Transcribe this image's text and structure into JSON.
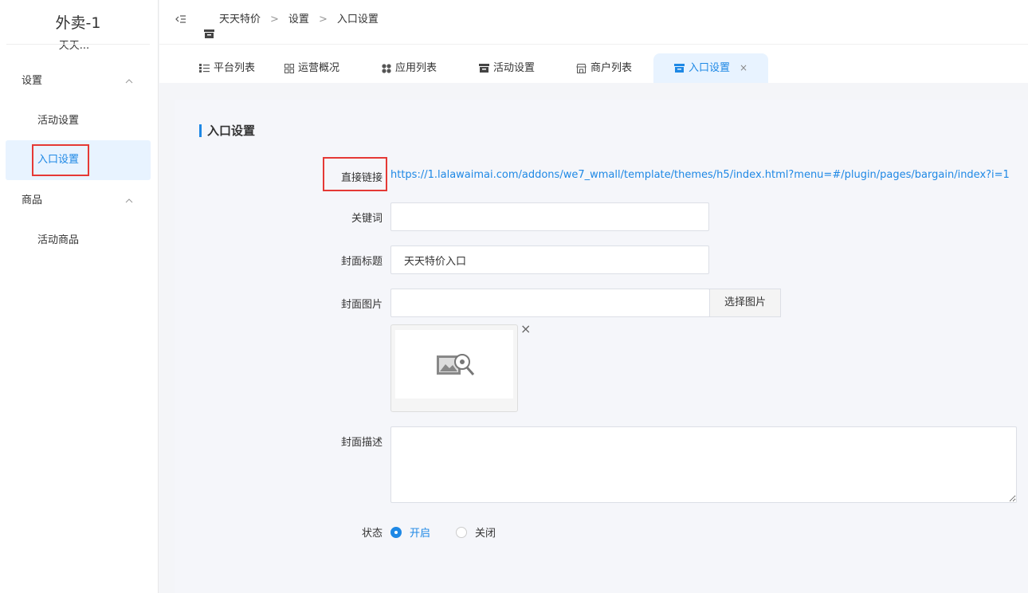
{
  "sidebar": {
    "app_title": "外卖-1",
    "app_subtitle": "天天...",
    "groups": [
      {
        "label": "设置",
        "items": [
          {
            "label": "活动设置"
          },
          {
            "label": "入口设置"
          }
        ]
      },
      {
        "label": "商品",
        "items": [
          {
            "label": "活动商品"
          }
        ]
      }
    ]
  },
  "breadcrumb": [
    "天天特价",
    "设置",
    "入口设置"
  ],
  "breadcrumb_sep": ">",
  "tabs": [
    {
      "label": "平台列表",
      "icon": "list-icon"
    },
    {
      "label": "运营概况",
      "icon": "grid-icon"
    },
    {
      "label": "应用列表",
      "icon": "apps-icon"
    },
    {
      "label": "活动设置",
      "icon": "archive-icon"
    },
    {
      "label": "商户列表",
      "icon": "store-icon"
    },
    {
      "label": "入口设置",
      "icon": "archive-icon",
      "active": true
    }
  ],
  "tab_close": "×",
  "page": {
    "section_title": "入口设置",
    "link_label": "直接链接",
    "link_value": "https://1.lalawaimai.com/addons/we7_wmall/template/themes/h5/index.html?menu=#/plugin/pages/bargain/index?i=1",
    "keyword_label": "关键词",
    "keyword_value": "",
    "cover_title_label": "封面标题",
    "cover_title_value": "天天特价入口",
    "cover_image_label": "封面图片",
    "cover_image_value": "",
    "pick_image_button": "选择图片",
    "image_remove": "×",
    "cover_desc_label": "封面描述",
    "cover_desc_value": "",
    "status_label": "状态",
    "status_on": "开启",
    "status_off": "关闭",
    "status_selected": "开启"
  },
  "colors": {
    "accent": "#1e88e5",
    "highlight": "#e53935",
    "active_bg": "#e8f3ff"
  }
}
